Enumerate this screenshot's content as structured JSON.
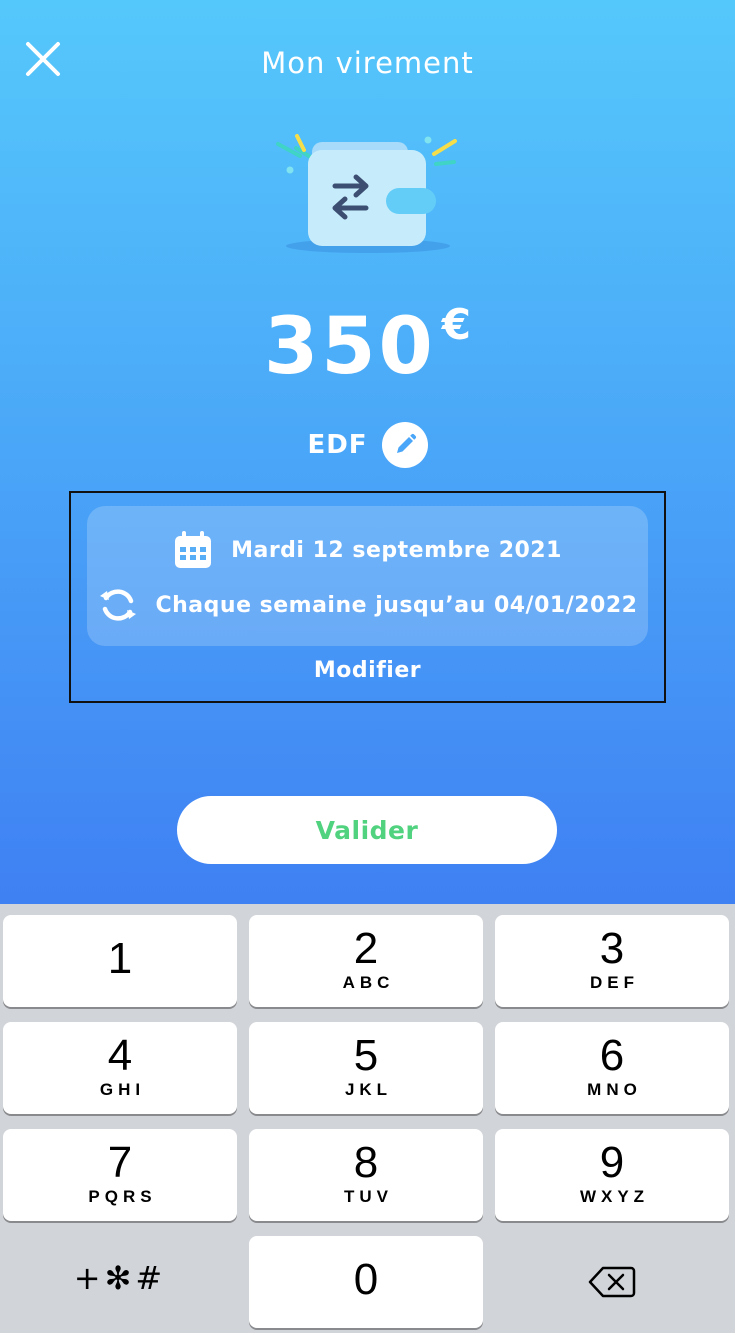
{
  "header": {
    "title": "Mon virement",
    "close_icon": "close-icon"
  },
  "transfer": {
    "amount": "350",
    "currency": "€",
    "recipient": "EDF",
    "edit_icon": "pencil-icon"
  },
  "schedule": {
    "date_icon": "calendar-icon",
    "date_text": "Mardi 12 septembre 2021",
    "repeat_icon": "refresh-icon",
    "repeat_text": "Chaque semaine jusqu’au 04/01/2022",
    "modify_label": "Modifier"
  },
  "actions": {
    "validate_label": "Valider"
  },
  "keypad": {
    "keys": [
      {
        "digit": "1",
        "letters": ""
      },
      {
        "digit": "2",
        "letters": "ABC"
      },
      {
        "digit": "3",
        "letters": "DEF"
      },
      {
        "digit": "4",
        "letters": "GHI"
      },
      {
        "digit": "5",
        "letters": "JKL"
      },
      {
        "digit": "6",
        "letters": "MNO"
      },
      {
        "digit": "7",
        "letters": "PQRS"
      },
      {
        "digit": "8",
        "letters": "TUV"
      },
      {
        "digit": "9",
        "letters": "WXYZ"
      },
      {
        "digit": "0",
        "letters": ""
      }
    ],
    "symbols_label": "+✻#",
    "delete_icon": "backspace-icon"
  },
  "colors": {
    "gradient_top": "#55c8fb",
    "gradient_bottom": "#3f80f3",
    "validate_text": "#50d27f",
    "keypad_background": "#d1d4d9"
  }
}
